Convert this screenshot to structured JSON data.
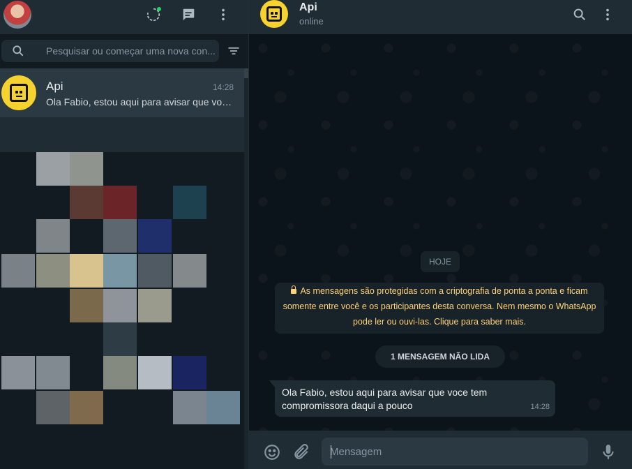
{
  "left": {
    "search": {
      "placeholder": "Pesquisar ou começar uma nova con..."
    },
    "chat": {
      "name": "Api",
      "time": "14:28",
      "preview": "Ola Fabio, estou aqui para avisar que voc..."
    }
  },
  "right": {
    "contact": {
      "name": "Api",
      "status": "online"
    },
    "date_label": "HOJE",
    "encryption_notice": "As mensagens são protegidas com a criptografia de ponta a ponta e ficam somente entre você e os participantes desta conversa. Nem mesmo o WhatsApp pode ler ou ouvi-las. Clique para saber mais.",
    "unread_label": "1 MENSAGEM NÃO LIDA",
    "message": {
      "text": "Ola Fabio, estou aqui para avisar que voce tem compromissora daqui a pouco",
      "time": "14:28"
    },
    "composer": {
      "placeholder": "Mensagem"
    }
  },
  "colors": {
    "header_bg": "#202c33",
    "panel_bg": "#111b21",
    "chat_bg": "#0b141a",
    "notice_text": "#ffd279",
    "avatar_yellow": "#f5d22e"
  },
  "icons": [
    "status-icon",
    "new-chat-icon",
    "menu-icon",
    "search-icon",
    "filter-icon",
    "emoji-icon",
    "attach-icon",
    "mic-icon"
  ]
}
